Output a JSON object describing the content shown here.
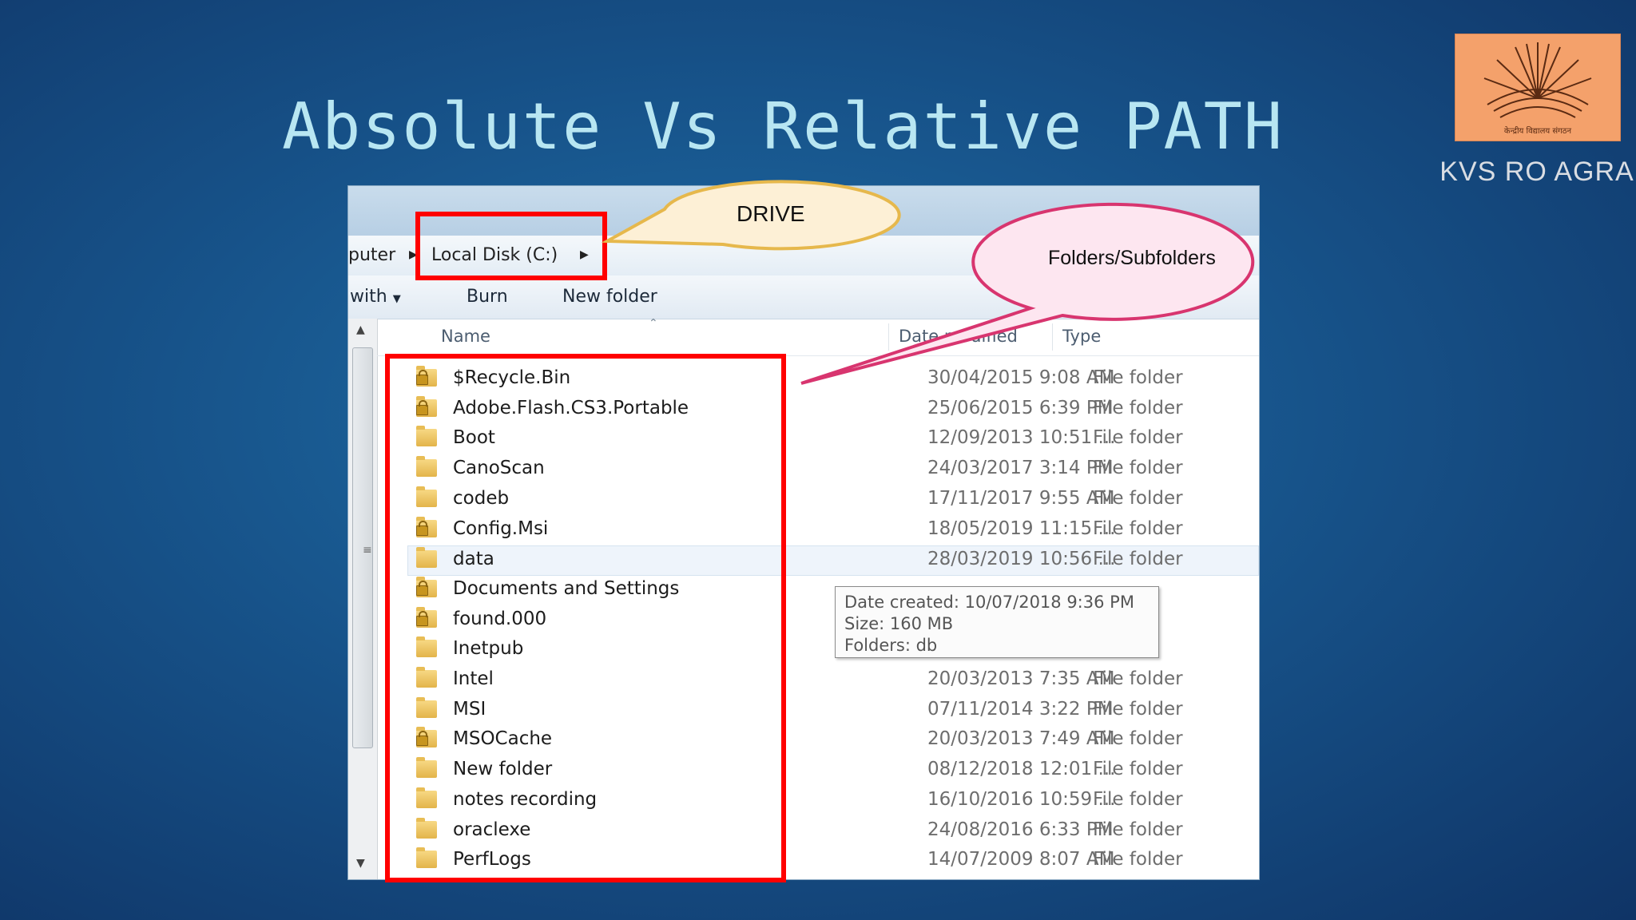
{
  "slide": {
    "title": "Absolute Vs Relative PATH"
  },
  "logo": {
    "caption": "KVS RO AGRA",
    "seal_text": "केन्द्रीय विद्यालय संगठन"
  },
  "address_bar": {
    "parent": "puter",
    "current": "Local Disk (C:)"
  },
  "toolbar": {
    "share_with": "with",
    "burn": "Burn",
    "new_folder": "New folder"
  },
  "columns": {
    "name": "Name",
    "date": "Date modified",
    "type": "Type"
  },
  "files": [
    {
      "name": "$Recycle.Bin",
      "date": "30/04/2015 9:08 AM",
      "type": "File folder",
      "icon": "locked-folder-icon"
    },
    {
      "name": "Adobe.Flash.CS3.Portable",
      "date": "25/06/2015 6:39 PM",
      "type": "File folder",
      "icon": "locked-folder-icon"
    },
    {
      "name": "Boot",
      "date": "12/09/2013 10:51 ...",
      "type": "File folder",
      "icon": "folder-icon"
    },
    {
      "name": "CanoScan",
      "date": "24/03/2017 3:14 PM",
      "type": "File folder",
      "icon": "folder-icon"
    },
    {
      "name": "codeb",
      "date": "17/11/2017 9:55 AM",
      "type": "File folder",
      "icon": "folder-icon"
    },
    {
      "name": "Config.Msi",
      "date": "18/05/2019 11:15 ...",
      "type": "File folder",
      "icon": "locked-folder-icon"
    },
    {
      "name": "data",
      "date": "28/03/2019 10:56 ...",
      "type": "File folder",
      "icon": "folder-icon"
    },
    {
      "name": "Documents and Settings",
      "date": "",
      "type": "",
      "icon": "locked-folder-icon"
    },
    {
      "name": "found.000",
      "date": "",
      "type": "",
      "icon": "locked-folder-icon"
    },
    {
      "name": "Inetpub",
      "date": "",
      "type": "",
      "icon": "folder-icon"
    },
    {
      "name": "Intel",
      "date": "20/03/2013 7:35 AM",
      "type": "File folder",
      "icon": "folder-icon"
    },
    {
      "name": "MSI",
      "date": "07/11/2014 3:22 PM",
      "type": "File folder",
      "icon": "folder-icon"
    },
    {
      "name": "MSOCache",
      "date": "20/03/2013 7:49 AM",
      "type": "File folder",
      "icon": "locked-folder-icon"
    },
    {
      "name": "New folder",
      "date": "08/12/2018 12:01 ...",
      "type": "File folder",
      "icon": "folder-icon"
    },
    {
      "name": "notes recording",
      "date": "16/10/2016 10:59 ...",
      "type": "File folder",
      "icon": "folder-icon"
    },
    {
      "name": "oraclexe",
      "date": "24/08/2016 6:33 PM",
      "type": "File folder",
      "icon": "folder-icon"
    },
    {
      "name": "PerfLogs",
      "date": "14/07/2009 8:07 AM",
      "type": "File folder",
      "icon": "folder-icon"
    }
  ],
  "hovered_row": 6,
  "tooltip": {
    "created": "Date created: 10/07/2018 9:36 PM",
    "size": "Size: 160 MB",
    "folders": "Folders: db"
  },
  "callouts": {
    "drive": "DRIVE",
    "folders": "Folders/Subfolders"
  },
  "colors": {
    "highlight_box": "#ff0000",
    "drive_callout_fill": "#fdf0d6",
    "drive_callout_border": "#e6b84c",
    "folders_callout_fill": "#fde6f0",
    "folders_callout_border": "#d8356f"
  }
}
